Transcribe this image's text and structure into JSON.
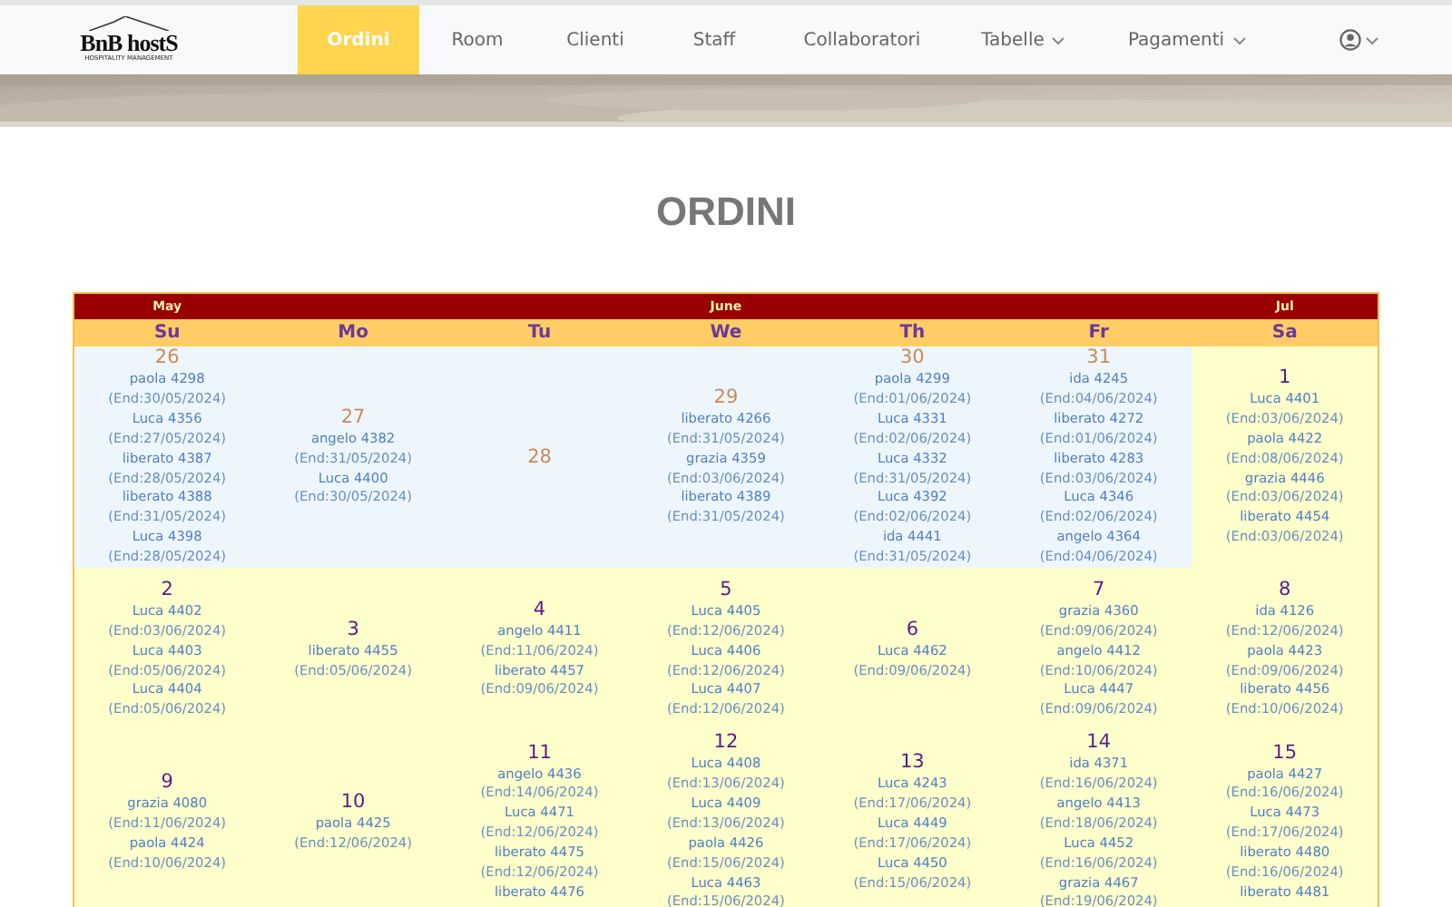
{
  "navbar": {
    "logo": {
      "name": "BnB hostS",
      "tagline": "HOSPITALITY MANAGEMENT"
    },
    "items": [
      {
        "label": "Ordini",
        "selected": true,
        "dropdown": false
      },
      {
        "label": "Room",
        "selected": false,
        "dropdown": false
      },
      {
        "label": "Clienti",
        "selected": false,
        "dropdown": false
      },
      {
        "label": "Staff",
        "selected": false,
        "dropdown": false
      },
      {
        "label": "Collaboratori",
        "selected": false,
        "dropdown": false
      },
      {
        "label": "Tabelle",
        "selected": false,
        "dropdown": true
      },
      {
        "label": "Pagamenti",
        "selected": false,
        "dropdown": true
      }
    ],
    "user_menu": {
      "dropdown": true
    }
  },
  "page_title": "ORDINI",
  "calendar": {
    "months": [
      "May",
      "June",
      "Jul"
    ],
    "weekdays": [
      "Su",
      "Mo",
      "Tu",
      "We",
      "Th",
      "Fr",
      "Sa"
    ],
    "weeks": [
      [
        {
          "day": "26",
          "in_month": false,
          "orders": [
            {
              "name": "paola 4298",
              "end": "(End:30/05/2024)"
            },
            {
              "name": "Luca 4356",
              "end": "(End:27/05/2024)"
            },
            {
              "name": "liberato 4387",
              "end": "(End:28/05/2024)"
            },
            {
              "name": "liberato 4388",
              "end": "(End:31/05/2024)"
            },
            {
              "name": "Luca 4398",
              "end": "(End:28/05/2024)"
            }
          ]
        },
        {
          "day": "27",
          "in_month": false,
          "orders": [
            {
              "name": "angelo 4382",
              "end": "(End:31/05/2024)"
            },
            {
              "name": "Luca 4400",
              "end": "(End:30/05/2024)"
            }
          ]
        },
        {
          "day": "28",
          "in_month": false
        },
        {
          "day": "29",
          "in_month": false,
          "orders": [
            {
              "name": "liberato 4266",
              "end": "(End:31/05/2024)"
            },
            {
              "name": "grazia 4359",
              "end": "(End:03/06/2024)"
            },
            {
              "name": "liberato 4389",
              "end": "(End:31/05/2024)"
            }
          ]
        },
        {
          "day": "30",
          "in_month": false,
          "orders": [
            {
              "name": "paola 4299",
              "end": "(End:01/06/2024)"
            },
            {
              "name": "Luca 4331",
              "end": "(End:02/06/2024)"
            },
            {
              "name": "Luca 4332",
              "end": "(End:31/05/2024)"
            },
            {
              "name": "Luca 4392",
              "end": "(End:02/06/2024)"
            },
            {
              "name": "ida 4441",
              "end": "(End:31/05/2024)"
            }
          ]
        },
        {
          "day": "31",
          "in_month": false,
          "orders": [
            {
              "name": "ida 4245",
              "end": "(End:04/06/2024)"
            },
            {
              "name": "liberato 4272",
              "end": "(End:01/06/2024)"
            },
            {
              "name": "liberato 4283",
              "end": "(End:03/06/2024)"
            },
            {
              "name": "Luca 4346",
              "end": "(End:02/06/2024)"
            },
            {
              "name": "angelo 4364",
              "end": "(End:04/06/2024)"
            }
          ]
        },
        {
          "day": "1",
          "in_month": true,
          "orders": [
            {
              "name": "Luca 4401",
              "end": "(End:03/06/2024)"
            },
            {
              "name": "paola 4422",
              "end": "(End:08/06/2024)"
            },
            {
              "name": "grazia 4446",
              "end": "(End:03/06/2024)"
            },
            {
              "name": "liberato 4454",
              "end": "(End:03/06/2024)"
            }
          ]
        }
      ],
      [
        {
          "day": "2",
          "in_month": true,
          "orders": [
            {
              "name": "Luca 4402",
              "end": "(End:03/06/2024)"
            },
            {
              "name": "Luca 4403",
              "end": "(End:05/06/2024)"
            },
            {
              "name": "Luca 4404",
              "end": "(End:05/06/2024)"
            }
          ]
        },
        {
          "day": "3",
          "in_month": true,
          "orders": [
            {
              "name": "liberato 4455",
              "end": "(End:05/06/2024)"
            }
          ]
        },
        {
          "day": "4",
          "in_month": true,
          "orders": [
            {
              "name": "angelo 4411",
              "end": "(End:11/06/2024)"
            },
            {
              "name": "liberato 4457",
              "end": "(End:09/06/2024)"
            }
          ]
        },
        {
          "day": "5",
          "in_month": true,
          "orders": [
            {
              "name": "Luca 4405",
              "end": "(End:12/06/2024)"
            },
            {
              "name": "Luca 4406",
              "end": "(End:12/06/2024)"
            },
            {
              "name": "Luca 4407",
              "end": "(End:12/06/2024)"
            }
          ]
        },
        {
          "day": "6",
          "in_month": true,
          "orders": [
            {
              "name": "Luca 4462",
              "end": "(End:09/06/2024)"
            }
          ]
        },
        {
          "day": "7",
          "in_month": true,
          "orders": [
            {
              "name": "grazia 4360",
              "end": "(End:09/06/2024)"
            },
            {
              "name": "angelo 4412",
              "end": "(End:10/06/2024)"
            },
            {
              "name": "Luca 4447",
              "end": "(End:09/06/2024)"
            }
          ]
        },
        {
          "day": "8",
          "in_month": true,
          "orders": [
            {
              "name": "ida 4126",
              "end": "(End:12/06/2024)"
            },
            {
              "name": "paola 4423",
              "end": "(End:09/06/2024)"
            },
            {
              "name": "liberato 4456",
              "end": "(End:10/06/2024)"
            }
          ]
        }
      ],
      [
        {
          "day": "9",
          "in_month": true,
          "orders": [
            {
              "name": "grazia 4080",
              "end": "(End:11/06/2024)"
            },
            {
              "name": "paola 4424",
              "end": "(End:10/06/2024)"
            }
          ]
        },
        {
          "day": "10",
          "in_month": true,
          "orders": [
            {
              "name": "paola 4425",
              "end": "(End:12/06/2024)"
            }
          ]
        },
        {
          "day": "11",
          "in_month": true,
          "orders": [
            {
              "name": "angelo 4436",
              "end": "(End:14/06/2024)"
            },
            {
              "name": "Luca 4471",
              "end": "(End:12/06/2024)"
            },
            {
              "name": "liberato 4475",
              "end": "(End:12/06/2024)"
            },
            {
              "name": "liberato 4476"
            }
          ]
        },
        {
          "day": "12",
          "in_month": true,
          "orders": [
            {
              "name": "Luca 4408",
              "end": "(End:13/06/2024)"
            },
            {
              "name": "Luca 4409",
              "end": "(End:13/06/2024)"
            },
            {
              "name": "paola 4426",
              "end": "(End:15/06/2024)"
            },
            {
              "name": "Luca 4463",
              "end": "(End:15/06/2024)"
            }
          ]
        },
        {
          "day": "13",
          "in_month": true,
          "orders": [
            {
              "name": "Luca 4243",
              "end": "(End:17/06/2024)"
            },
            {
              "name": "Luca 4449",
              "end": "(End:17/06/2024)"
            },
            {
              "name": "Luca 4450",
              "end": "(End:15/06/2024)"
            }
          ]
        },
        {
          "day": "14",
          "in_month": true,
          "orders": [
            {
              "name": "ida 4371",
              "end": "(End:16/06/2024)"
            },
            {
              "name": "angelo 4413",
              "end": "(End:18/06/2024)"
            },
            {
              "name": "Luca 4452",
              "end": "(End:16/06/2024)"
            },
            {
              "name": "grazia 4467",
              "end": "(End:19/06/2024)"
            }
          ]
        },
        {
          "day": "15",
          "in_month": true,
          "orders": [
            {
              "name": "paola 4427",
              "end": "(End:16/06/2024)"
            },
            {
              "name": "Luca 4473",
              "end": "(End:17/06/2024)"
            },
            {
              "name": "liberato 4480",
              "end": "(End:16/06/2024)"
            },
            {
              "name": "liberato 4481"
            }
          ]
        }
      ]
    ]
  }
}
